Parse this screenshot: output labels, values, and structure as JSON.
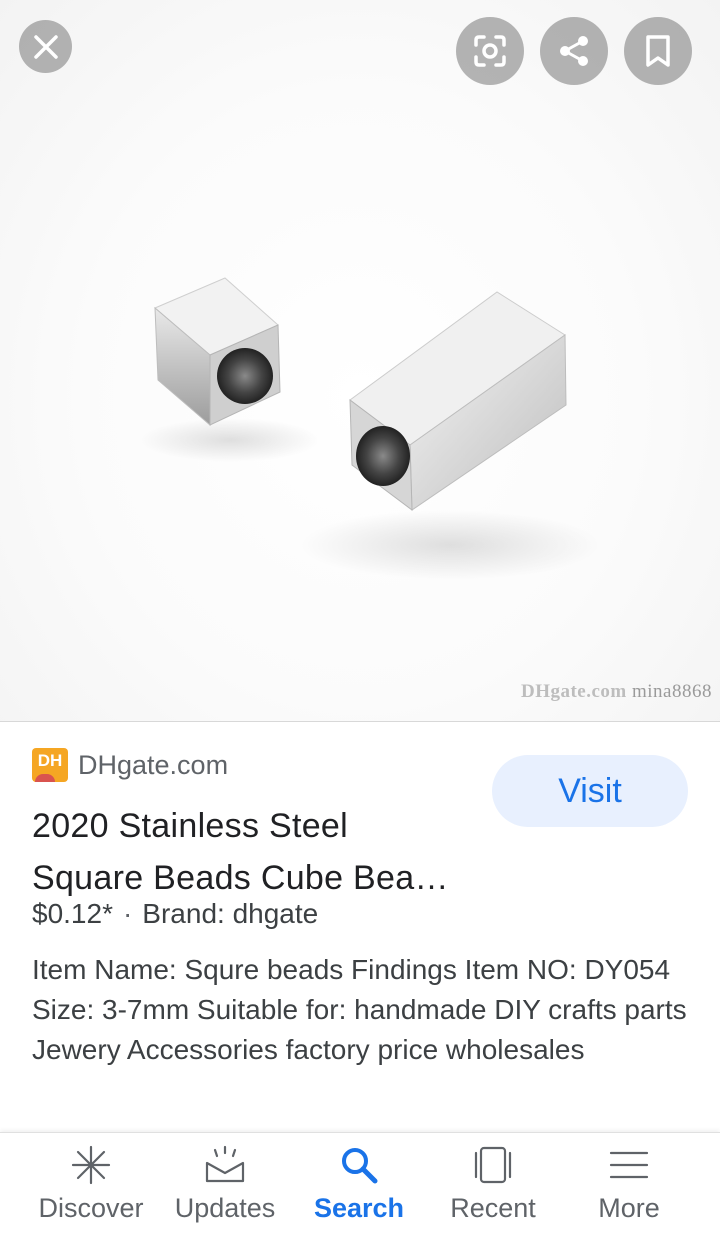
{
  "image": {
    "watermark_logo": "DHgate.com",
    "watermark_user": "mina8868",
    "actions": {
      "close_icon": "close-icon",
      "lens_icon": "lens-icon",
      "share_icon": "share-icon",
      "save_icon": "bookmark-icon"
    }
  },
  "result": {
    "source": "DHgate.com",
    "favicon_text": "DH",
    "visit_label": "Visit",
    "title_line1": "2020 Stainless Steel",
    "title_line2": "Square Beads Cube Bea…",
    "price": "$0.12*",
    "separator": "·",
    "brand": "Brand: dhgate",
    "description": "Item Name: Squre beads Findings Item NO: DY054 Size: 3-7mm Suitable for: handmade DIY crafts parts Jewery Accessories factory price wholesales"
  },
  "nav": {
    "items": [
      {
        "label": "Discover",
        "icon": "asterisk-icon"
      },
      {
        "label": "Updates",
        "icon": "inbox-icon"
      },
      {
        "label": "Search",
        "icon": "search-icon"
      },
      {
        "label": "Recent",
        "icon": "tabs-icon"
      },
      {
        "label": "More",
        "icon": "menu-icon"
      }
    ],
    "active": "Search"
  },
  "colors": {
    "accent": "#1a73e8",
    "visit_bg": "#e8f0fe",
    "favicon": "#f5a623"
  }
}
